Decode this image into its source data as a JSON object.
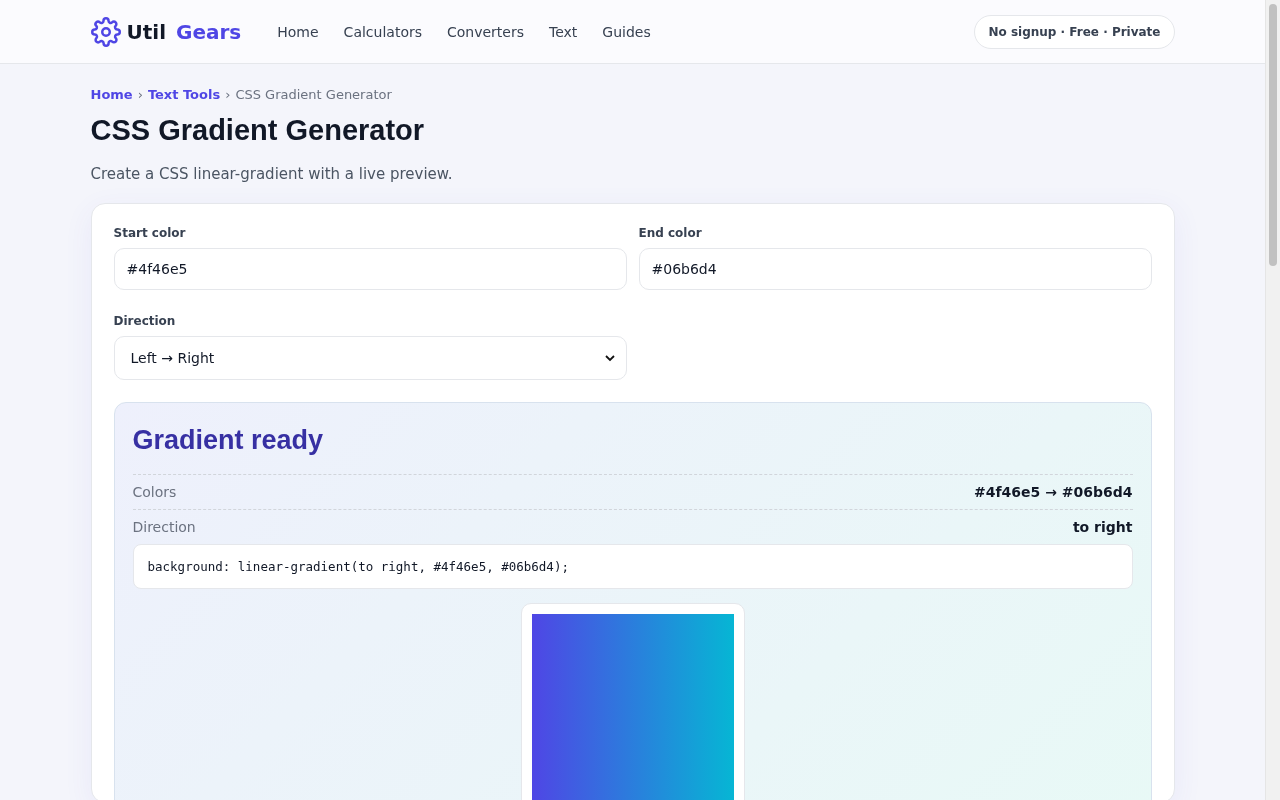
{
  "header": {
    "logo": {
      "part1": "Util",
      "part2": "Gears"
    },
    "nav": [
      {
        "label": "Home"
      },
      {
        "label": "Calculators"
      },
      {
        "label": "Converters"
      },
      {
        "label": "Text"
      },
      {
        "label": "Guides"
      }
    ],
    "badge": "No signup · Free · Private"
  },
  "breadcrumb": {
    "links": [
      "Home",
      "Text Tools"
    ],
    "separator": "›",
    "current": "CSS Gradient Generator"
  },
  "title": "CSS Gradient Generator",
  "subtitle": "Create a CSS linear-gradient with a live preview.",
  "form": {
    "start": {
      "label": "Start color",
      "value": "#4f46e5"
    },
    "end": {
      "label": "End color",
      "value": "#06b6d4"
    },
    "direction": {
      "label": "Direction",
      "value": "Left → Right"
    }
  },
  "result": {
    "heading": "Gradient ready",
    "rows": [
      {
        "label": "Colors",
        "value": "#4f46e5 → #06b6d4"
      },
      {
        "label": "Direction",
        "value": "to right"
      }
    ],
    "code": "background: linear-gradient(to right, #4f46e5, #06b6d4);"
  }
}
